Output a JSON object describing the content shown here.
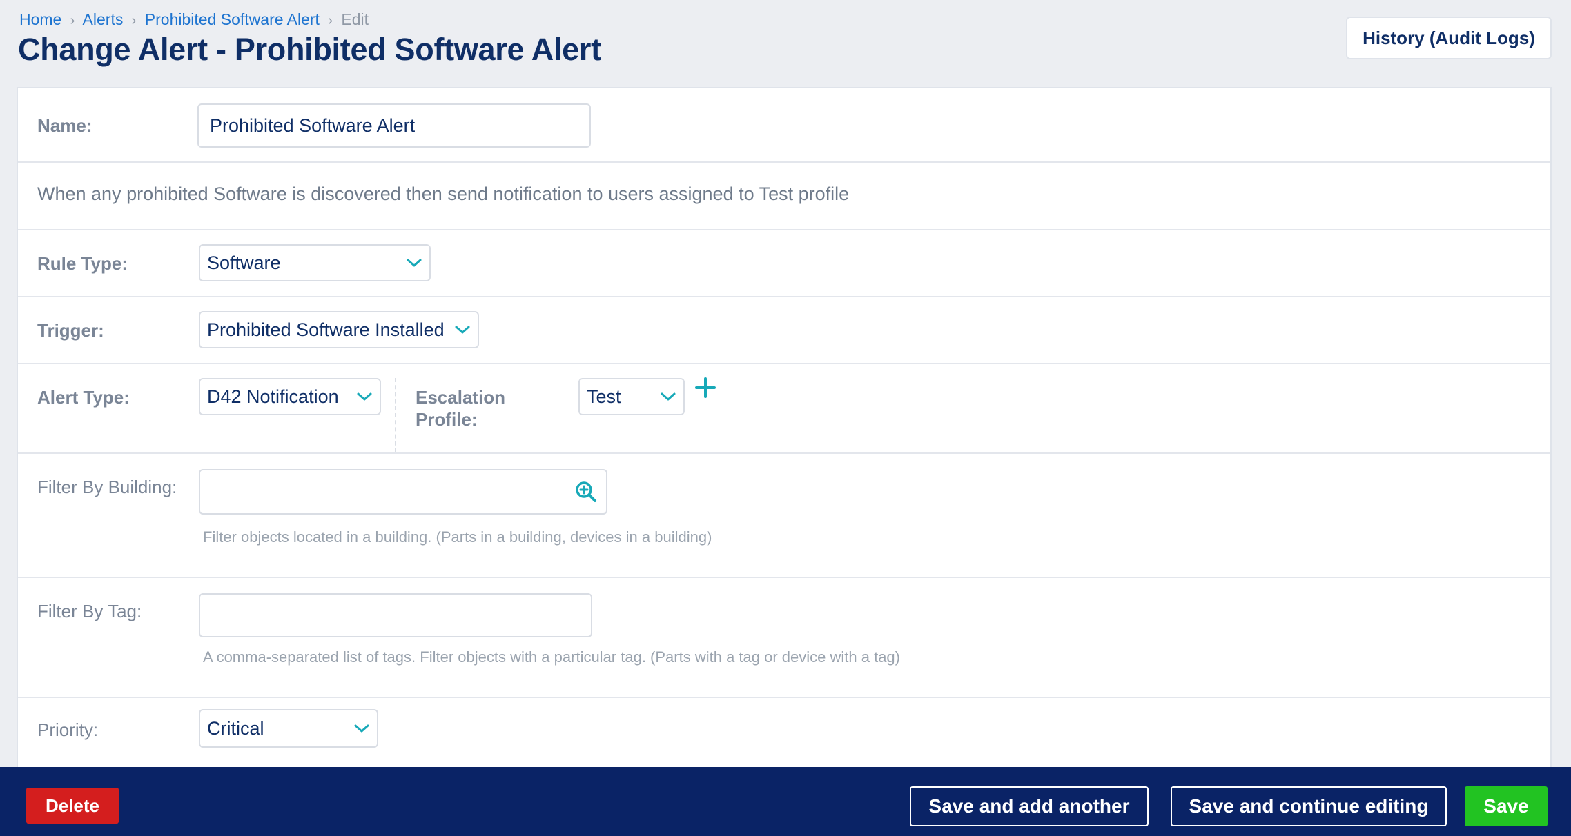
{
  "breadcrumb": {
    "items": [
      "Home",
      "Alerts",
      "Prohibited Software Alert"
    ],
    "current": "Edit",
    "separator": "›"
  },
  "page": {
    "title": "Change Alert - Prohibited Software Alert",
    "history_button": "History (Audit Logs)"
  },
  "form": {
    "name": {
      "label": "Name:",
      "value": "Prohibited Software Alert"
    },
    "description": "When any prohibited Software is discovered then send notification to users assigned to Test profile",
    "rule_type": {
      "label": "Rule Type:",
      "value": "Software"
    },
    "trigger": {
      "label": "Trigger:",
      "value": "Prohibited Software Installed"
    },
    "alert_type": {
      "label": "Alert Type:",
      "value": "D42 Notification"
    },
    "escalation_profile": {
      "label_line1": "Escalation",
      "label_line2": "Profile:",
      "value": "Test"
    },
    "filter_building": {
      "label": "Filter By Building:",
      "value": "",
      "help": "Filter objects located in a building. (Parts in a building, devices in a building)"
    },
    "filter_tag": {
      "label": "Filter By Tag:",
      "value": "",
      "help": "A comma-separated list of tags. Filter objects with a particular tag. (Parts with a tag or device with a tag)"
    },
    "priority": {
      "label": "Priority:",
      "value": "Critical"
    }
  },
  "footer": {
    "delete": "Delete",
    "save_add_another": "Save and add another",
    "save_continue": "Save and continue editing",
    "save": "Save"
  },
  "colors": {
    "brand_navy": "#0a2366",
    "accent_teal": "#17a9b8",
    "link_blue": "#1e74d0",
    "delete_red": "#d41e1e",
    "save_green": "#22c322"
  }
}
